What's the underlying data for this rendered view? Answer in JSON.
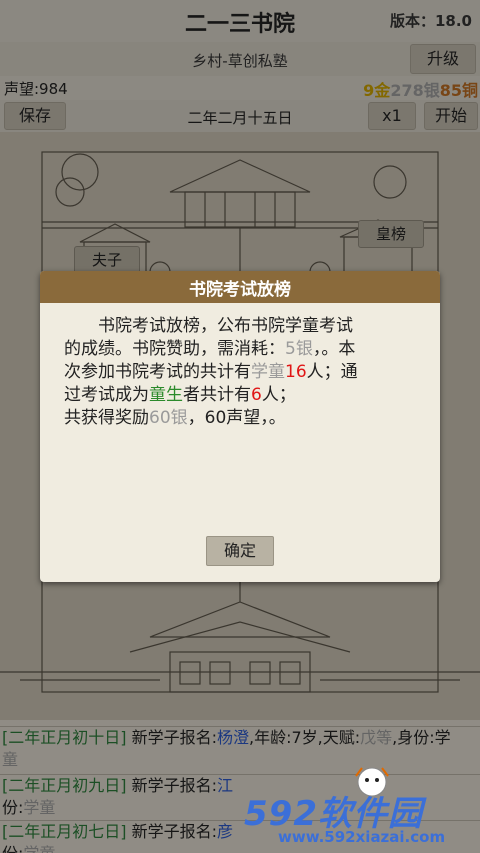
{
  "header": {
    "title": "二一三书院",
    "version": "版本：18.0"
  },
  "bar2": {
    "village": "乡村-草创私塾",
    "upgrade_label": "升级"
  },
  "stats": {
    "prestige": "声望:984",
    "gold": "9金",
    "silver": "278银",
    "copper": "85铜"
  },
  "bar4": {
    "save_label": "保存",
    "date": "二年二月十五日",
    "speed_label": "x1",
    "start_label": "开始"
  },
  "scene": {
    "teacher_label": "夫子",
    "ranking_label": "皇榜"
  },
  "dialog": {
    "title": "书院考试放榜",
    "line1": "书院考试放榜，公布书院学童考试",
    "line2a": "的成绩。书院赞助，需消耗：",
    "line2b": "5银",
    "line2c": "，。本",
    "line3a": "次参加书院考试的共计有",
    "line3b": "学童",
    "line3c": "16",
    "line3d": "人；通",
    "line4a": "过考试成为",
    "line4b": "童生",
    "line4c": "者共计有",
    "line4d": "6",
    "line4e": "人；",
    "line5a": "共获得奖励",
    "line5b": "60银",
    "line5c": "，60声望，。",
    "ok_label": "确定"
  },
  "log": [
    {
      "date": "[二年正月初十日]",
      "text": " 新学子报名:",
      "name": "杨澄",
      "rest": ",年龄:7岁,天赋:",
      "talent": "戊等",
      "rest2": ",身份:学",
      "cont": "童"
    },
    {
      "date": "[二年正月初九日]",
      "text": " 新学子报名:",
      "name": "江",
      "cont_prefix": "份:",
      "cont": "学童"
    },
    {
      "date": "[二年正月初七日]",
      "text": " 新学子报名:",
      "name": "彦",
      "cont_prefix": "份:",
      "cont": "学童"
    }
  ],
  "watermark": {
    "brand": "592软件园",
    "url": "www.592xiazai.com"
  }
}
